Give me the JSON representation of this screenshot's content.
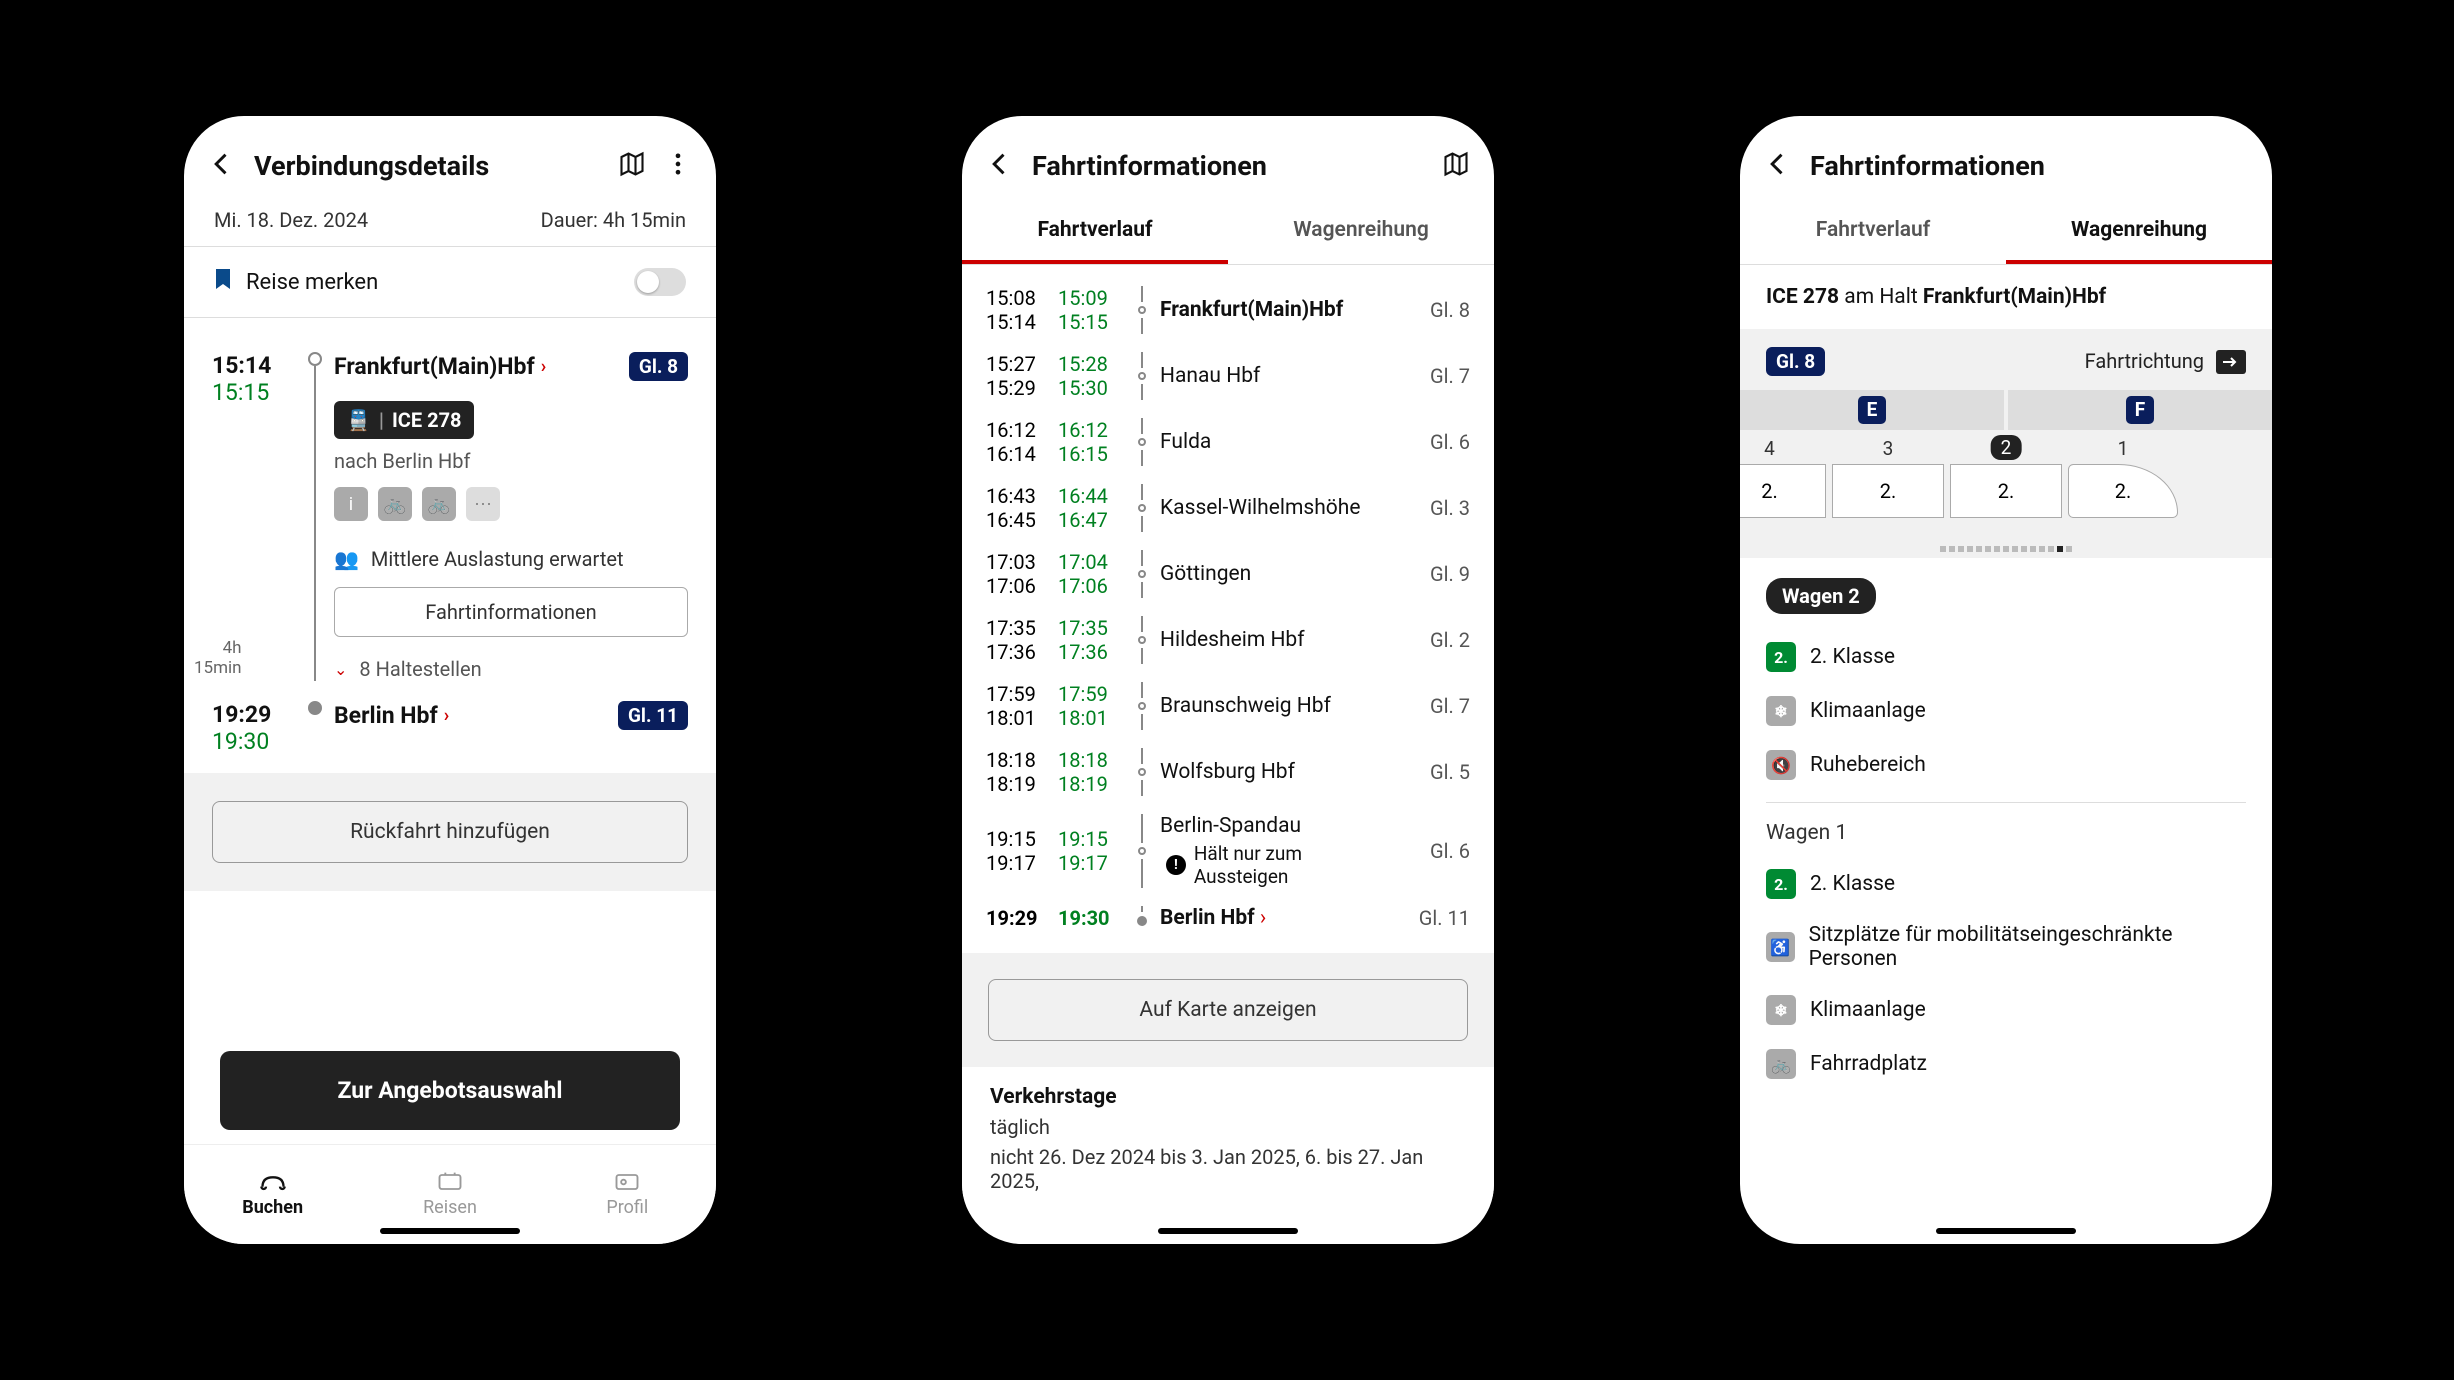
{
  "phone1": {
    "header": {
      "title": "Verbindungsdetails"
    },
    "meta": {
      "date": "Mi. 18. Dez. 2024",
      "duration": "Dauer: 4h 15min"
    },
    "save": {
      "label": "Reise merken"
    },
    "dep": {
      "sched": "15:14",
      "real": "15:15",
      "station": "Frankfurt(Main)Hbf",
      "platform": "Gl. 8"
    },
    "train": {
      "label": "ICE 278",
      "dest": "nach Berlin Hbf"
    },
    "load": "Mittlere Auslastung erwartet",
    "info_btn": "Fahrtinformationen",
    "stops": "8 Haltestellen",
    "arr": {
      "sched": "19:29",
      "real": "19:30",
      "station": "Berlin Hbf",
      "platform": "Gl. 11"
    },
    "dur_note_1": "4h",
    "dur_note_2": "15min",
    "add_return": "Rückfahrt hinzufügen",
    "cta": "Zur Angebotsauswahl",
    "nav": {
      "buchen": "Buchen",
      "reisen": "Reisen",
      "profil": "Profil"
    }
  },
  "phone2": {
    "header": {
      "title": "Fahrtinformationen"
    },
    "tabs": {
      "verlauf": "Fahrtverlauf",
      "reihung": "Wagenreihung"
    },
    "stops": [
      {
        "arr": "15:08",
        "dep": "15:14",
        "rarr": "15:09",
        "rdep": "15:15",
        "name": "Frankfurt(Main)Hbf",
        "plat": "Gl. 8",
        "bold": true
      },
      {
        "arr": "15:27",
        "dep": "15:29",
        "rarr": "15:28",
        "rdep": "15:30",
        "name": "Hanau Hbf",
        "plat": "Gl. 7"
      },
      {
        "arr": "16:12",
        "dep": "16:14",
        "rarr": "16:12",
        "rdep": "16:15",
        "name": "Fulda",
        "plat": "Gl. 6"
      },
      {
        "arr": "16:43",
        "dep": "16:45",
        "rarr": "16:44",
        "rdep": "16:47",
        "name": "Kassel-Wilhelmshöhe",
        "plat": "Gl. 3"
      },
      {
        "arr": "17:03",
        "dep": "17:06",
        "rarr": "17:04",
        "rdep": "17:06",
        "name": "Göttingen",
        "plat": "Gl. 9"
      },
      {
        "arr": "17:35",
        "dep": "17:36",
        "rarr": "17:35",
        "rdep": "17:36",
        "name": "Hildesheim Hbf",
        "plat": "Gl. 2"
      },
      {
        "arr": "17:59",
        "dep": "18:01",
        "rarr": "17:59",
        "rdep": "18:01",
        "name": "Braunschweig Hbf",
        "plat": "Gl. 7"
      },
      {
        "arr": "18:18",
        "dep": "18:19",
        "rarr": "18:18",
        "rdep": "18:19",
        "name": "Wolfsburg Hbf",
        "plat": "Gl. 5"
      },
      {
        "arr": "19:15",
        "dep": "19:17",
        "rarr": "19:15",
        "rdep": "19:17",
        "name": "Berlin-Spandau",
        "plat": "Gl. 6",
        "note": "Hält nur zum Aussteigen"
      }
    ],
    "final": {
      "sched": "19:29",
      "real": "19:30",
      "name": "Berlin Hbf",
      "plat": "Gl. 11"
    },
    "map_btn": "Auf Karte anzeigen",
    "service": {
      "heading": "Verkehrstage",
      "daily": "täglich",
      "except": "nicht 26. Dez 2024 bis 3. Jan 2025, 6. bis 27. Jan 2025,"
    }
  },
  "phone3": {
    "header": {
      "title": "Fahrtinformationen"
    },
    "tabs": {
      "verlauf": "Fahrtverlauf",
      "reihung": "Wagenreihung"
    },
    "context_prefix": "ICE 278",
    "context_mid": " am Halt ",
    "context_station": "Frankfurt(Main)Hbf",
    "platform": "Gl. 8",
    "direction": "Fahrtrichtung",
    "sectors": [
      "E",
      "F"
    ],
    "coaches": [
      {
        "num": "4",
        "cls": "2."
      },
      {
        "num": "3",
        "cls": "2."
      },
      {
        "num": "2",
        "cls": "2.",
        "selected": true
      },
      {
        "num": "1",
        "cls": "2.",
        "engine": true
      }
    ],
    "wagon2": {
      "chip": "Wagen 2",
      "class": "2. Klasse",
      "ac": "Klimaanlage",
      "quiet": "Ruhebereich"
    },
    "wagon1": {
      "title": "Wagen 1",
      "class": "2. Klasse",
      "mobility": "Sitzplätze für mobilitätseingeschränkte Personen",
      "ac": "Klimaanlage",
      "bike": "Fahrradplatz"
    }
  }
}
